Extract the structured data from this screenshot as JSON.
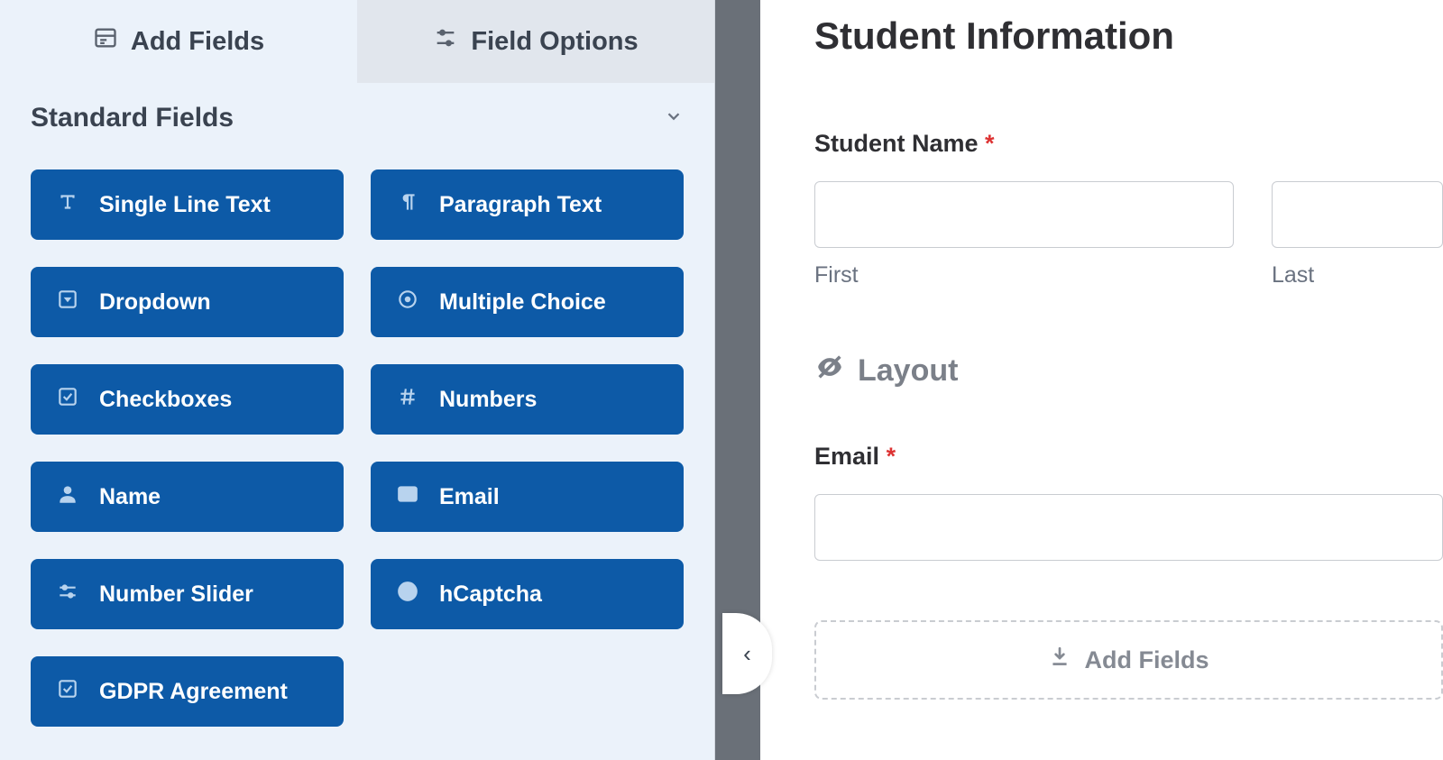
{
  "tabs": {
    "add_fields": "Add Fields",
    "field_options": "Field Options"
  },
  "section": {
    "title": "Standard Fields"
  },
  "fields": {
    "single_line_text": "Single Line Text",
    "paragraph_text": "Paragraph Text",
    "dropdown": "Dropdown",
    "multiple_choice": "Multiple Choice",
    "checkboxes": "Checkboxes",
    "numbers": "Numbers",
    "name": "Name",
    "email": "Email",
    "number_slider": "Number Slider",
    "hcaptcha": "hCaptcha",
    "gdpr_agreement": "GDPR Agreement"
  },
  "form": {
    "title": "Student Information",
    "student_name_label": "Student Name",
    "first_sublabel": "First",
    "last_sublabel": "Last",
    "layout_label": "Layout",
    "email_label": "Email",
    "required_mark": "*",
    "add_fields_drop": "Add Fields"
  }
}
